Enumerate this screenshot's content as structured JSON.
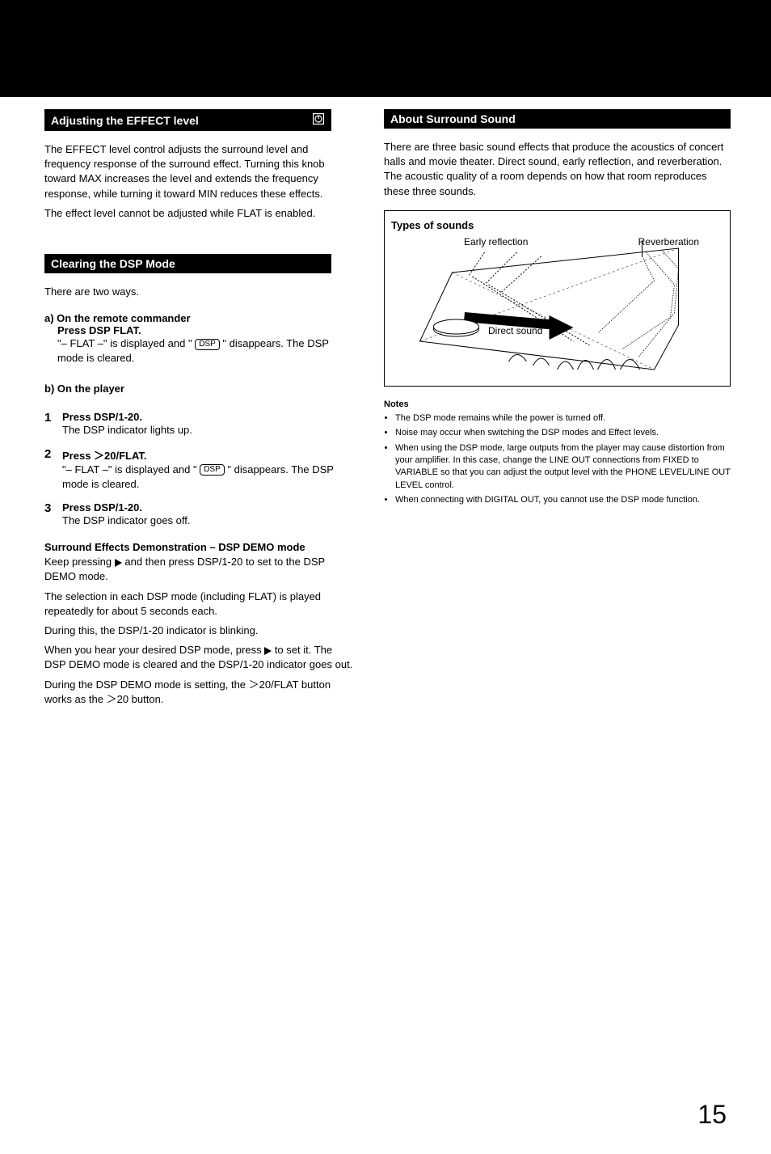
{
  "left": {
    "section1": {
      "heading": "Adjusting the EFFECT level",
      "p1": "The EFFECT level control adjusts the surround level and frequency response of the surround effect. Turning this knob toward MAX increases the level and extends the frequency response, while turning it toward MIN reduces these effects.",
      "p2": "The effect level cannot be adjusted while FLAT is enabled."
    },
    "section2": {
      "heading": "Clearing the DSP Mode",
      "intro": "There are two ways.",
      "a_label": "a) On the remote commander",
      "a_bold": "Press DSP FLAT.",
      "a_pre": "\"– FLAT –\" is displayed and \"",
      "a_dsp": "DSP",
      "a_post": "\" disappears. The DSP mode is cleared.",
      "b_label": "b) On the player",
      "steps": [
        {
          "num": "1",
          "bold": "Press DSP/1-20.",
          "text": "The DSP indicator lights up."
        },
        {
          "num": "2",
          "bold": "Press ＞20/FLAT.",
          "pre": "\"– FLAT –\" is displayed and \" ",
          "dsp": "DSP",
          "post": " \" disappears. The DSP mode is cleared."
        },
        {
          "num": "3",
          "bold": "Press DSP/1-20.",
          "text": "The DSP indicator goes off."
        }
      ],
      "demo": {
        "heading": "Surround Effects Demonstration – DSP DEMO mode",
        "l1a": "Keep pressing ",
        "l1b": " and then press DSP/1-20 to set to the DSP DEMO mode.",
        "l2": "The selection in each DSP mode (including FLAT) is played repeatedly for about 5 seconds each.",
        "l3": "During this, the DSP/1-20 indicator is blinking.",
        "l4a": "When you hear your desired DSP mode, press ",
        "l4b": " to set it. The DSP DEMO mode is cleared and the DSP/1-20 indicator goes out.",
        "l5": "During the DSP DEMO mode is setting, the ＞20/FLAT button works as the ＞20 button."
      }
    }
  },
  "right": {
    "heading": "About Surround Sound",
    "intro": "There are three basic sound effects that produce the acoustics of concert halls and movie theater. Direct sound, early reflection, and reverberation. The acoustic quality of a room depends on how that room reproduces these three sounds.",
    "box": {
      "title": "Types of sounds",
      "early": "Early reflection",
      "reverb": "Reverberation",
      "direct": "Direct sound"
    },
    "notes_heading": "Notes",
    "notes": [
      "The DSP mode remains while the power is turned off.",
      "Noise may occur when switching the DSP modes and Effect levels.",
      "When using the DSP mode, large outputs from the player may cause distortion from your amplifier.\nIn this case, change the LINE OUT connections from FIXED to VARIABLE so that you can adjust the output level with the PHONE LEVEL/LINE OUT LEVEL control.",
      "When connecting with DIGITAL OUT, you cannot use the DSP mode function."
    ]
  },
  "page_number": "15"
}
